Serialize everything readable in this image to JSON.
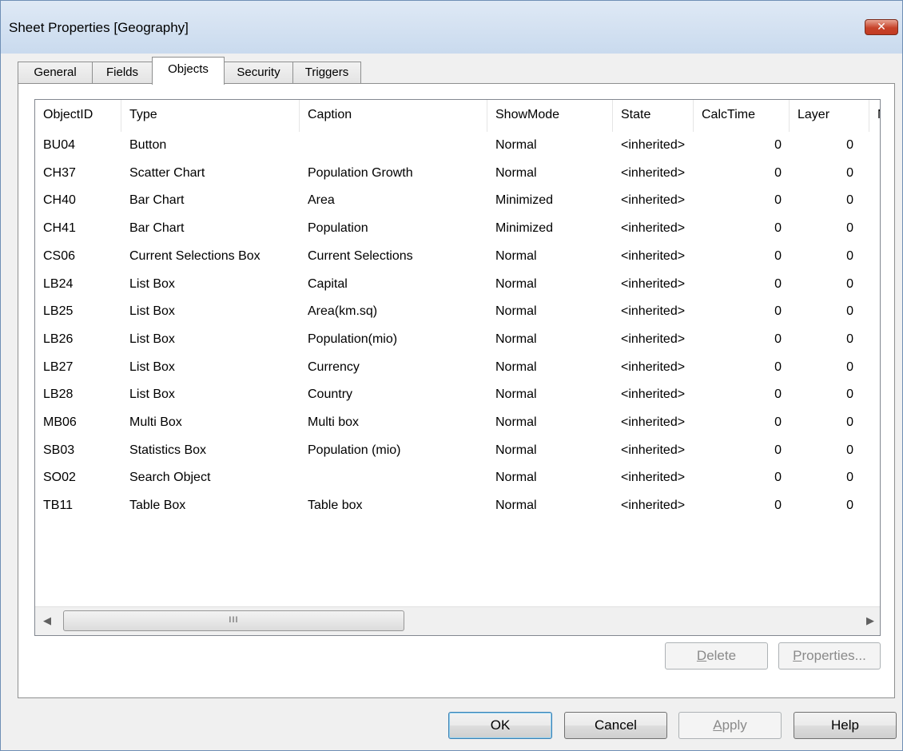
{
  "window": {
    "title": "Sheet Properties [Geography]",
    "close_glyph": "✕"
  },
  "tabs": [
    {
      "label": "General"
    },
    {
      "label": "Fields"
    },
    {
      "label": "Objects"
    },
    {
      "label": "Security"
    },
    {
      "label": "Triggers"
    }
  ],
  "active_tab": "Objects",
  "table": {
    "columns": [
      "ObjectID",
      "Type",
      "Caption",
      "ShowMode",
      "State",
      "CalcTime",
      "Layer",
      "M"
    ],
    "rows": [
      {
        "id": "BU04",
        "type": "Button",
        "caption": "",
        "showmode": "Normal",
        "state": "<inherited>",
        "calctime": "0",
        "layer": "0"
      },
      {
        "id": "CH37",
        "type": "Scatter Chart",
        "caption": "Population Growth",
        "showmode": "Normal",
        "state": "<inherited>",
        "calctime": "0",
        "layer": "0"
      },
      {
        "id": "CH40",
        "type": "Bar Chart",
        "caption": "Area",
        "showmode": "Minimized",
        "state": "<inherited>",
        "calctime": "0",
        "layer": "0"
      },
      {
        "id": "CH41",
        "type": "Bar Chart",
        "caption": "Population",
        "showmode": "Minimized",
        "state": "<inherited>",
        "calctime": "0",
        "layer": "0"
      },
      {
        "id": "CS06",
        "type": "Current Selections Box",
        "caption": "Current Selections",
        "showmode": "Normal",
        "state": "<inherited>",
        "calctime": "0",
        "layer": "0"
      },
      {
        "id": "LB24",
        "type": "List Box",
        "caption": "Capital",
        "showmode": "Normal",
        "state": "<inherited>",
        "calctime": "0",
        "layer": "0"
      },
      {
        "id": "LB25",
        "type": "List Box",
        "caption": "Area(km.sq)",
        "showmode": "Normal",
        "state": "<inherited>",
        "calctime": "0",
        "layer": "0"
      },
      {
        "id": "LB26",
        "type": "List Box",
        "caption": "Population(mio)",
        "showmode": "Normal",
        "state": "<inherited>",
        "calctime": "0",
        "layer": "0"
      },
      {
        "id": "LB27",
        "type": "List Box",
        "caption": "Currency",
        "showmode": "Normal",
        "state": "<inherited>",
        "calctime": "0",
        "layer": "0"
      },
      {
        "id": "LB28",
        "type": "List Box",
        "caption": "Country",
        "showmode": "Normal",
        "state": "<inherited>",
        "calctime": "0",
        "layer": "0"
      },
      {
        "id": "MB06",
        "type": "Multi Box",
        "caption": "Multi box",
        "showmode": "Normal",
        "state": "<inherited>",
        "calctime": "0",
        "layer": "0"
      },
      {
        "id": "SB03",
        "type": "Statistics Box",
        "caption": "Population (mio)",
        "showmode": "Normal",
        "state": "<inherited>",
        "calctime": "0",
        "layer": "0"
      },
      {
        "id": "SO02",
        "type": "Search Object",
        "caption": "",
        "showmode": "Normal",
        "state": "<inherited>",
        "calctime": "0",
        "layer": "0"
      },
      {
        "id": "TB11",
        "type": "Table Box",
        "caption": "Table box",
        "showmode": "Normal",
        "state": "<inherited>",
        "calctime": "0",
        "layer": "0"
      }
    ]
  },
  "scrollbar": {
    "left_arrow": "◀",
    "right_arrow": "▶",
    "grip": "III"
  },
  "panel_buttons": {
    "delete": {
      "underlined": "D",
      "rest": "elete"
    },
    "properties": {
      "underlined": "P",
      "rest": "roperties..."
    }
  },
  "dialog_buttons": {
    "ok": "OK",
    "cancel": "Cancel",
    "apply": {
      "underlined": "A",
      "rest": "pply"
    },
    "help": "Help"
  }
}
